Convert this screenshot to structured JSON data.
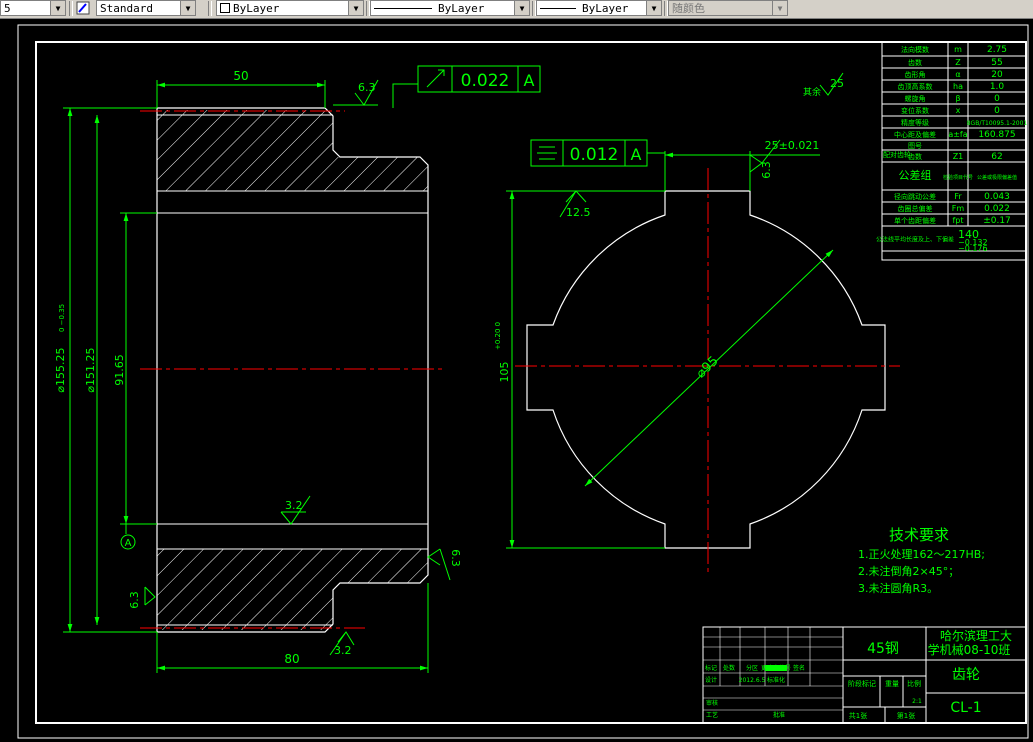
{
  "toolbar": {
    "left_fragment": "5",
    "text_style": "Standard",
    "layer": "ByLayer",
    "linetype": "ByLayer",
    "lineweight": "ByLayer",
    "color": "随颜色"
  },
  "drawing": {
    "dim_width_top": "50",
    "dim_width_bottom": "80",
    "dim_od": "⌀155.25",
    "dim_od_tol": "0 −0.35",
    "dim_pitch": "⌀151.25",
    "dim_bore": "91.65",
    "datum": "A",
    "rough_63": "6.3",
    "rough_32": "3.2",
    "rough_125": "12.5",
    "runout_value": "0.022",
    "sym_value": "0.012",
    "key_width": "25±0.021",
    "key_depth": "105",
    "key_depth_tol": "+0.20 0",
    "bore_dia": "⌀95",
    "other_rough": "25",
    "other_rough_label": "其余"
  },
  "params": [
    {
      "name": "法向模数",
      "sym": "m",
      "val": "2.75"
    },
    {
      "name": "齿数",
      "sym": "Z",
      "val": "55"
    },
    {
      "name": "齿形角",
      "sym": "α",
      "val": "20"
    },
    {
      "name": "齿顶高系数",
      "sym": "ha",
      "val": "1.0"
    },
    {
      "name": "螺旋角",
      "sym": "β",
      "val": "0"
    },
    {
      "name": "变位系数",
      "sym": "x",
      "val": "0"
    },
    {
      "name": "精度等级",
      "sym": "",
      "val": "8GB/T10095.1-2001"
    },
    {
      "name": "中心距及偏差",
      "sym": "a±fa",
      "val": "160.875"
    },
    {
      "name": "图号",
      "sym": "",
      "val": ""
    },
    {
      "name": "齿数",
      "sym": "Z1",
      "val": "62"
    },
    {
      "name": "公差组",
      "sym": "检验项目代号",
      "val": "公差或极限偏差值"
    },
    {
      "name": "径向跳动公差",
      "sym": "Fr",
      "val": "0.043"
    },
    {
      "name": "齿圈总偏差",
      "sym": "Fm",
      "val": "0.022"
    },
    {
      "name": "单个齿距偏差",
      "sym": "fpt",
      "val": "±0.17"
    },
    {
      "name": "公法线平均长度及上、下偏差",
      "sym": "",
      "val": "140",
      "tol1": "−0.132",
      "tol2": "−0.176"
    }
  ],
  "paired_gear_label": "配对齿轮",
  "tech": {
    "title": "技术要求",
    "items": [
      "1.正火处理162～217HB;",
      "2.未注倒角2×45°；",
      "3.未注圆角R3。"
    ]
  },
  "titleblock": {
    "material": "45钢",
    "school1": "哈尔滨理工大",
    "school2": "学机械08-10班",
    "part": "齿轮",
    "code": "CL-1",
    "scale": "2:1",
    "row_labels": [
      "标记",
      "处数",
      "分区",
      "更改文件号",
      "签名",
      "设计",
      "",
      "2012.6.5",
      "标准化",
      "审核",
      "工艺",
      "批准"
    ],
    "stage_labels": [
      "阶段标记",
      "重量",
      "比例"
    ],
    "sheets": "共1张",
    "sheet_no": "第1张"
  }
}
